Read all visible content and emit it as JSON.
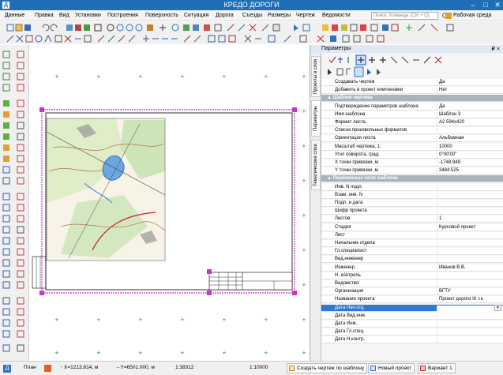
{
  "app": {
    "title": "КРЕДО ДОРОГИ",
    "icon_letter": "Д"
  },
  "menu": [
    "Данные",
    "Правка",
    "Вид",
    "Установки",
    "Построения",
    "Поверхность",
    "Ситуация",
    "Дорога",
    "Съезды",
    "Размеры",
    "Чертеж",
    "Ведомости"
  ],
  "search": {
    "placeholder": "Поиск: Команда (Ctrl + Q)"
  },
  "workspace": {
    "label": "Рабочая среда"
  },
  "panel": {
    "title": "Параметры",
    "pin": "₽ ×",
    "vtabs": [
      "Проекты и слои",
      "Параметры",
      "Тематические слои"
    ],
    "rows": [
      {
        "key": "Создавать чертеж",
        "value": "Да",
        "type": "prop"
      },
      {
        "key": "Добавить в проект компоновки",
        "value": "Нет",
        "type": "prop"
      },
      {
        "key": "Шаблон чертежа",
        "value": "",
        "type": "group"
      },
      {
        "key": "Подтверждение параметров шаблона",
        "value": "Да",
        "type": "prop"
      },
      {
        "key": "Имя шаблона",
        "value": "Шаблон 3",
        "type": "prop"
      },
      {
        "key": "Формат листа",
        "value": "A2 594x420",
        "type": "prop"
      },
      {
        "key": "Список произвольных форматов",
        "value": "",
        "type": "prop"
      },
      {
        "key": "Ориентация листа",
        "value": "Альбомная",
        "type": "prop"
      },
      {
        "key": "Масштаб чертежа, 1:",
        "value": "10000",
        "type": "prop"
      },
      {
        "key": "Угол поворота, град.",
        "value": "0°00'00\"",
        "type": "prop"
      },
      {
        "key": "X точки привязки, м",
        "value": "-1748.949",
        "type": "prop"
      },
      {
        "key": "Y точки привязки, м",
        "value": "3484.525",
        "type": "prop"
      },
      {
        "key": "Переменные поля шаблона",
        "value": "",
        "type": "group"
      },
      {
        "key": "Инв. N подл.",
        "value": "",
        "type": "prop"
      },
      {
        "key": "Взам. инв. N",
        "value": "",
        "type": "prop"
      },
      {
        "key": "Подп. и дата",
        "value": "",
        "type": "prop"
      },
      {
        "key": "Шифр проекта",
        "value": "",
        "type": "prop"
      },
      {
        "key": "Листов",
        "value": "1",
        "type": "prop"
      },
      {
        "key": "Стадия",
        "value": "Курсовой проект",
        "type": "prop"
      },
      {
        "key": "Лист",
        "value": "",
        "type": "prop"
      },
      {
        "key": "Начальник отдела",
        "value": "",
        "type": "prop"
      },
      {
        "key": "Гл.специалист",
        "value": "",
        "type": "prop"
      },
      {
        "key": "Вед.инженер",
        "value": "",
        "type": "prop"
      },
      {
        "key": "Инженер",
        "value": "Иванов В.В.",
        "type": "prop"
      },
      {
        "key": "Н. контроль",
        "value": "",
        "type": "prop"
      },
      {
        "key": "Ведомство",
        "value": "",
        "type": "prop"
      },
      {
        "key": "Организация",
        "value": "ВГТУ",
        "type": "prop"
      },
      {
        "key": "Название проекта",
        "value": "Проект дороги III т.к.",
        "type": "prop"
      },
      {
        "key": "Дата Нач.отд.",
        "value": "",
        "type": "selected"
      },
      {
        "key": "Дата Вед.инж.",
        "value": "",
        "type": "prop"
      },
      {
        "key": "Дата Инж.",
        "value": "",
        "type": "prop"
      },
      {
        "key": "Дата Гл.спец.",
        "value": "",
        "type": "prop"
      },
      {
        "key": "Дата Н.контр.",
        "value": "",
        "type": "prop"
      }
    ]
  },
  "status": {
    "tab": "План",
    "x": "↑ X=1213.814, м",
    "y": "→Y=6501.000, м",
    "scale1": "1:38312",
    "scale2": "1:10000",
    "btn_create": "Создать чертеж по шаблону",
    "btn_new": "Новый проект",
    "btn_variant": "Вариант 1"
  },
  "colors": {
    "titlebar": "#1f6fb6",
    "sheet_border": "#cc33cc",
    "selection": "#3078d6",
    "group_row": "#a9b3bf"
  }
}
